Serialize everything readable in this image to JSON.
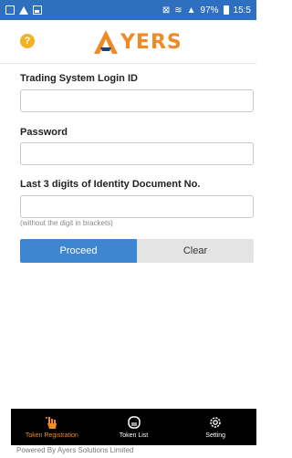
{
  "status_bar": {
    "battery": "97%",
    "time": "15:5"
  },
  "header": {
    "help_icon": "question-icon",
    "logo_text": "YERS",
    "accent_color": "#f08a24"
  },
  "form": {
    "login_id": {
      "label": "Trading System Login ID",
      "value": "",
      "placeholder": ""
    },
    "password": {
      "label": "Password",
      "value": "",
      "placeholder": ""
    },
    "id_digits": {
      "label": "Last 3 digits of Identity Document No.",
      "value": "",
      "placeholder": "",
      "hint": "(without the digit in brackets)"
    },
    "proceed_label": "Proceed",
    "clear_label": "Clear"
  },
  "tabbar": {
    "tabs": [
      {
        "label": "Token Registration",
        "icon": "hand-touch-icon",
        "active": true
      },
      {
        "label": "Token List",
        "icon": "token-icon",
        "active": false
      },
      {
        "label": "Setting",
        "icon": "gear-icon",
        "active": false
      }
    ]
  },
  "footer": {
    "text": "Powered By Ayers Solutions Limited"
  }
}
